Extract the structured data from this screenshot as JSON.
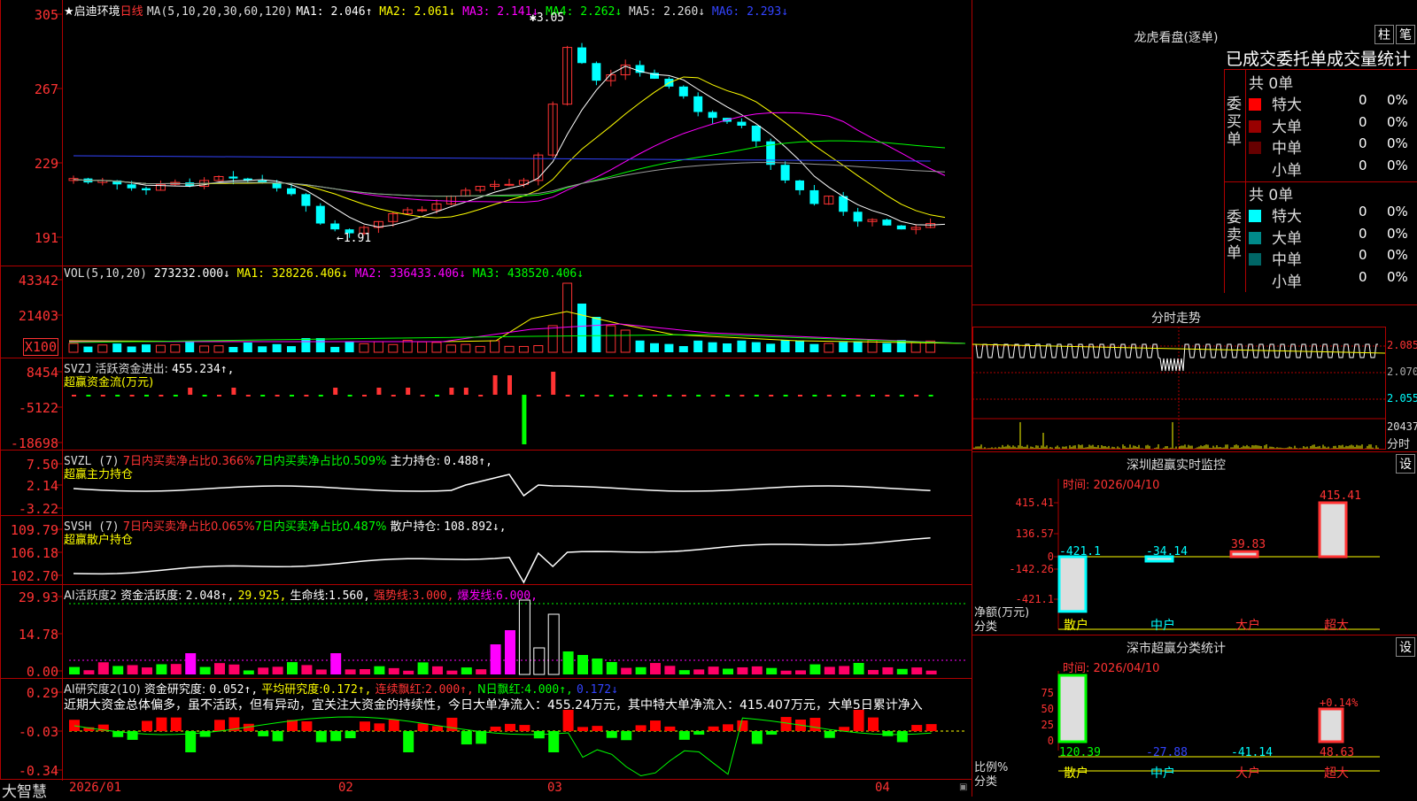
{
  "stock": {
    "name": "★启迪环境",
    "period": "日线",
    "ma_title": "MA(5,10,20,30,60,120)",
    "ma_values": [
      {
        "label": "MA1:",
        "value": "2.046↑",
        "color": "#ffffff"
      },
      {
        "label": "MA2:",
        "value": "2.061↓",
        "color": "#ffff00"
      },
      {
        "label": "MA3:",
        "value": "2.141↓",
        "color": "#ff00ff"
      },
      {
        "label": "MA4:",
        "value": "2.262↓",
        "color": "#00ff00"
      },
      {
        "label": "MA5:",
        "value": "2.260↓",
        "color": "#dddddd"
      },
      {
        "label": "MA6:",
        "value": "2.293↓",
        "color": "#3344ff"
      }
    ],
    "y_labels": [
      "305",
      "267",
      "229",
      "191"
    ],
    "high_mark": "3.05",
    "low_mark": "←1.91"
  },
  "vol": {
    "title": "VOL(5,10,20)",
    "value": "273232.000↓",
    "ma": [
      {
        "label": "MA1:",
        "value": "328226.406↓",
        "color": "#ffff00"
      },
      {
        "label": "MA2:",
        "value": "336433.406↓",
        "color": "#ff00ff"
      },
      {
        "label": "MA3:",
        "value": "438520.406↓",
        "color": "#00ff00"
      }
    ],
    "y_labels": [
      "43342",
      "21403",
      "X100"
    ]
  },
  "svzj": {
    "title": "SVZJ",
    "label": "活跃资金进出:",
    "value": "455.234↑,",
    "subtitle": "超赢资金流(万元)",
    "y_labels": [
      "8454",
      "-5122",
      "-18698"
    ]
  },
  "svzl": {
    "title": "SVZL (7)",
    "sell_label": "7日内买卖净占比0.366%",
    "buy_label": "7日内买卖净占比0.509%",
    "hold_label": "主力持仓:",
    "hold_value": "0.488↑,",
    "subtitle": "超赢主力持仓",
    "y_labels": [
      "7.50",
      "2.14",
      "-3.22"
    ]
  },
  "svsh": {
    "title": "SVSH (7)",
    "sell_label": "7日内买卖净占比0.065%",
    "buy_label": "7日内买卖净占比0.487%",
    "hold_label": "散户持仓:",
    "hold_value": "108.892↓,",
    "subtitle": "超赢散户持仓",
    "y_labels": [
      "109.79",
      "106.18",
      "102.70"
    ]
  },
  "ai_active": {
    "title": "AI活跃度2",
    "label": "资金活跃度:",
    "value1": "2.048↑,",
    "value2": "29.925,",
    "life_label": "生命线:",
    "life_value": "1.560,",
    "strong_label": "强势线:",
    "strong_value": "3.000,",
    "burst_label": "爆发线:",
    "burst_value": "6.000,",
    "y_labels": [
      "29.93",
      "14.78",
      "0.00"
    ]
  },
  "ai_research": {
    "title": "AI研究度2(10)",
    "label": "资金研究度:",
    "value": "0.052↑,",
    "avg_label": "平均研究度:",
    "avg_value": "0.172↑,",
    "streak_label": "连续飘红:",
    "streak_value": "2.000↑,",
    "n_label": "N日飘红:",
    "n_value": "4.000↑,",
    "last_value": "0.172↓",
    "comment": "近期大资金总体偏多，虽不活跃，但有异动，宜关注大资金的持续性，今日大单净流入：455.24万元，其中特大单净流入：415.407万元，大单5日累计净入",
    "y_labels": [
      "0.29",
      "-0.03",
      "-0.34"
    ]
  },
  "bottom": {
    "brand": "大智慧",
    "dates": [
      "2026/01",
      "02",
      "03",
      "04"
    ]
  },
  "longhu": {
    "title": "龙虎看盘(逐单)",
    "btn1": "柱",
    "btn2": "笔",
    "header": "已成交委托单成交量统计",
    "buy_side": "委买单",
    "sell_side": "委卖单",
    "buy_total": "共 0单",
    "sell_total": "共 0单",
    "buy_rows": [
      {
        "label": "特大",
        "v1": "0",
        "v2": "0%",
        "color": "#ff0000"
      },
      {
        "label": "大单",
        "v1": "0",
        "v2": "0%",
        "color": "#990000"
      },
      {
        "label": "中单",
        "v1": "0",
        "v2": "0%",
        "color": "#660000"
      },
      {
        "label": "小单",
        "v1": "0",
        "v2": "0%",
        "color": ""
      }
    ],
    "sell_rows": [
      {
        "label": "特大",
        "v1": "0",
        "v2": "0%",
        "color": "#00ffff"
      },
      {
        "label": "大单",
        "v1": "0",
        "v2": "0%",
        "color": "#008a8a"
      },
      {
        "label": "中单",
        "v1": "0",
        "v2": "0%",
        "color": "#006666"
      },
      {
        "label": "小单",
        "v1": "0",
        "v2": "0%",
        "color": ""
      }
    ]
  },
  "intraday": {
    "title": "分时走势",
    "prices": [
      "2.085",
      "2.070",
      "2.055"
    ],
    "vol_label": "20437",
    "time_label": "分时"
  },
  "monitor": {
    "title": "深圳超赢实时监控",
    "btn": "设",
    "date": "时间: 2026/04/10",
    "y_labels": [
      "415.41",
      "136.57",
      "0",
      "-142.26",
      "-421.1"
    ],
    "axis_label": "净额(万元)",
    "x_title": "分类",
    "categories": [
      "散户",
      "中户",
      "大户",
      "超大"
    ],
    "bar_values": [
      -421.1,
      -34.14,
      39.83,
      415.41
    ],
    "bar_labels": [
      "-421.1",
      "-34.14",
      "39.83",
      "415.41"
    ]
  },
  "classify": {
    "title": "深市超赢分类统计",
    "btn": "设",
    "date": "时间: 2026/04/10",
    "y_labels": [
      "75",
      "50",
      "25",
      "0"
    ],
    "axis_label": "比例%",
    "x_title": "分类",
    "categories": [
      "散户",
      "中户",
      "大户",
      "超大"
    ],
    "values": [
      "120.39",
      "-27.88",
      "-41.14",
      "48.63"
    ],
    "note": "+0.14%"
  }
}
